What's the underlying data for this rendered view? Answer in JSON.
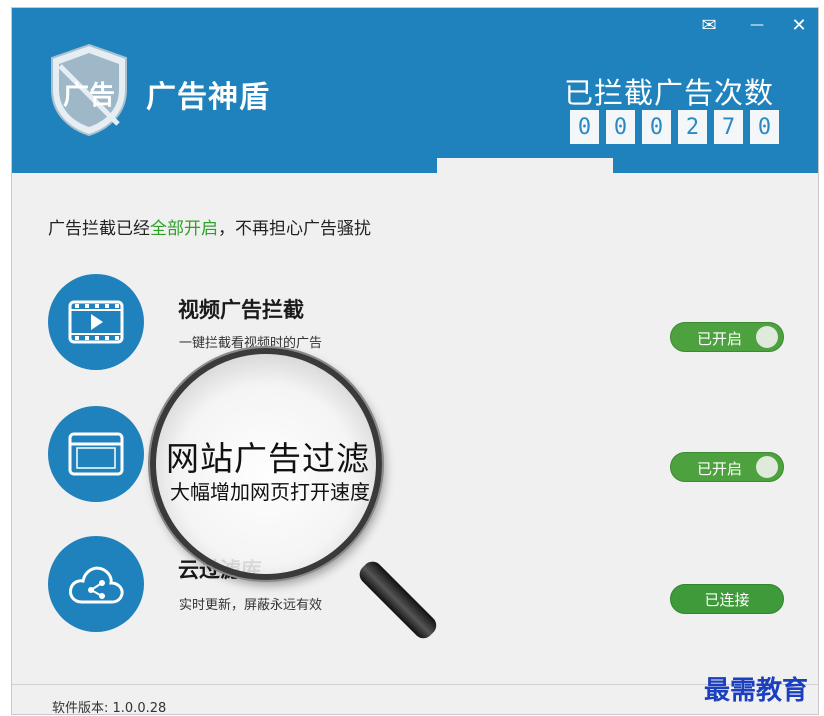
{
  "window": {
    "controls": [
      {
        "name": "feedback-mail-button",
        "icon": "mail-icon",
        "symbol": "✉"
      },
      {
        "name": "minimize-button",
        "icon": "minimize-icon",
        "symbol": "—"
      },
      {
        "name": "close-button",
        "icon": "close-icon",
        "symbol": "✕"
      }
    ]
  },
  "header": {
    "logo_text": "广告",
    "app_title": "广告神盾",
    "counter_label": "已拦截广告次数",
    "counter_digits": [
      "0",
      "0",
      "0",
      "2",
      "7",
      "0"
    ]
  },
  "status": {
    "prefix": "广告拦截已经",
    "highlight": "全部开启",
    "suffix": "，不再担心广告骚扰"
  },
  "features": [
    {
      "icon": "video-icon",
      "title": "视频广告拦截",
      "desc": "一键拦截看视频时的广告",
      "button": "已开启",
      "state": "on"
    },
    {
      "icon": "browser-window-icon",
      "title": "",
      "desc": "",
      "button": "已开启",
      "state": "on"
    },
    {
      "icon": "cloud-share-icon",
      "title": "云过滤库",
      "desc": "实时更新，屏蔽永远有效",
      "button": "已连接",
      "state": "connected"
    }
  ],
  "magnifier": {
    "title": "网站广告过滤",
    "subtitle": "大幅增加网页打开速度"
  },
  "footer": {
    "version": "软件版本: 1.0.0.28"
  },
  "watermark": "最需教育",
  "colors": {
    "header_blue": "#1f82bd",
    "toggle_green": "#4ea13f",
    "highlight_green": "#2fa128",
    "watermark_blue": "#1c3fbf"
  }
}
